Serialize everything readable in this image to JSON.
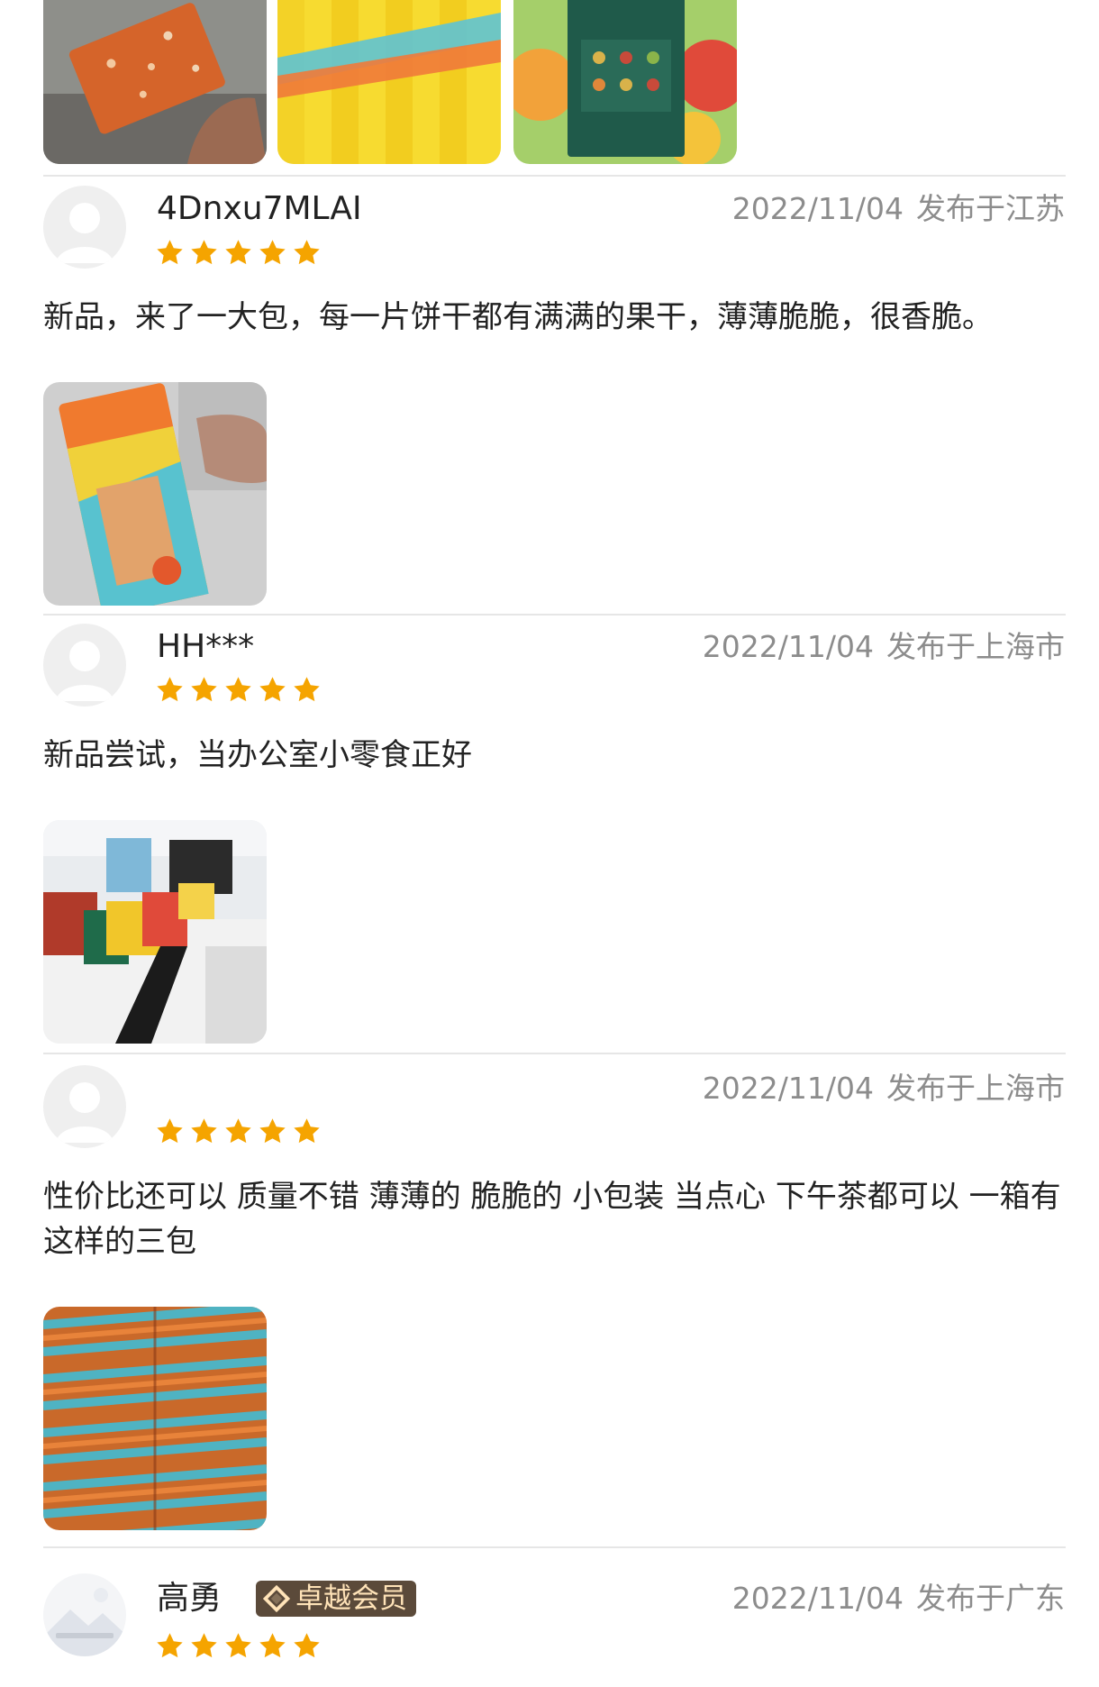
{
  "reviews": [
    {
      "username": "4Dnxu7MLAI",
      "date": "2022/11/04",
      "location": "发布于江苏",
      "rating": 5,
      "text": "新品，来了一大包，每一片饼干都有满满的果干，薄薄脆脆，很香脆。",
      "images": [
        "biscuit-package-photo"
      ]
    },
    {
      "username": "HH***",
      "date": "2022/11/04",
      "location": "发布于上海市",
      "rating": 5,
      "text": "新品尝试，当办公室小零食正好",
      "images": [
        "office-snacks-photo"
      ]
    },
    {
      "username": "",
      "date": "2022/11/04",
      "location": "发布于上海市",
      "rating": 5,
      "text": "性价比还可以 质量不错 薄薄的 脆脆的 小包装 当点心 下午茶都可以 一箱有这样的三包",
      "images": [
        "packets-pile-photo"
      ]
    },
    {
      "username": "高勇",
      "badge": "卓越会员",
      "date": "2022/11/04",
      "location": "发布于广东",
      "rating": 5
    }
  ],
  "top_images": [
    "biscuit-in-hand-photo",
    "yellow-packets-photo",
    "gift-box-photo"
  ],
  "colors": {
    "star": "#f5a400",
    "meta_text": "#8c8c8c",
    "badge_bg": "#5b4a3a",
    "badge_text": "#ffe3b8"
  }
}
